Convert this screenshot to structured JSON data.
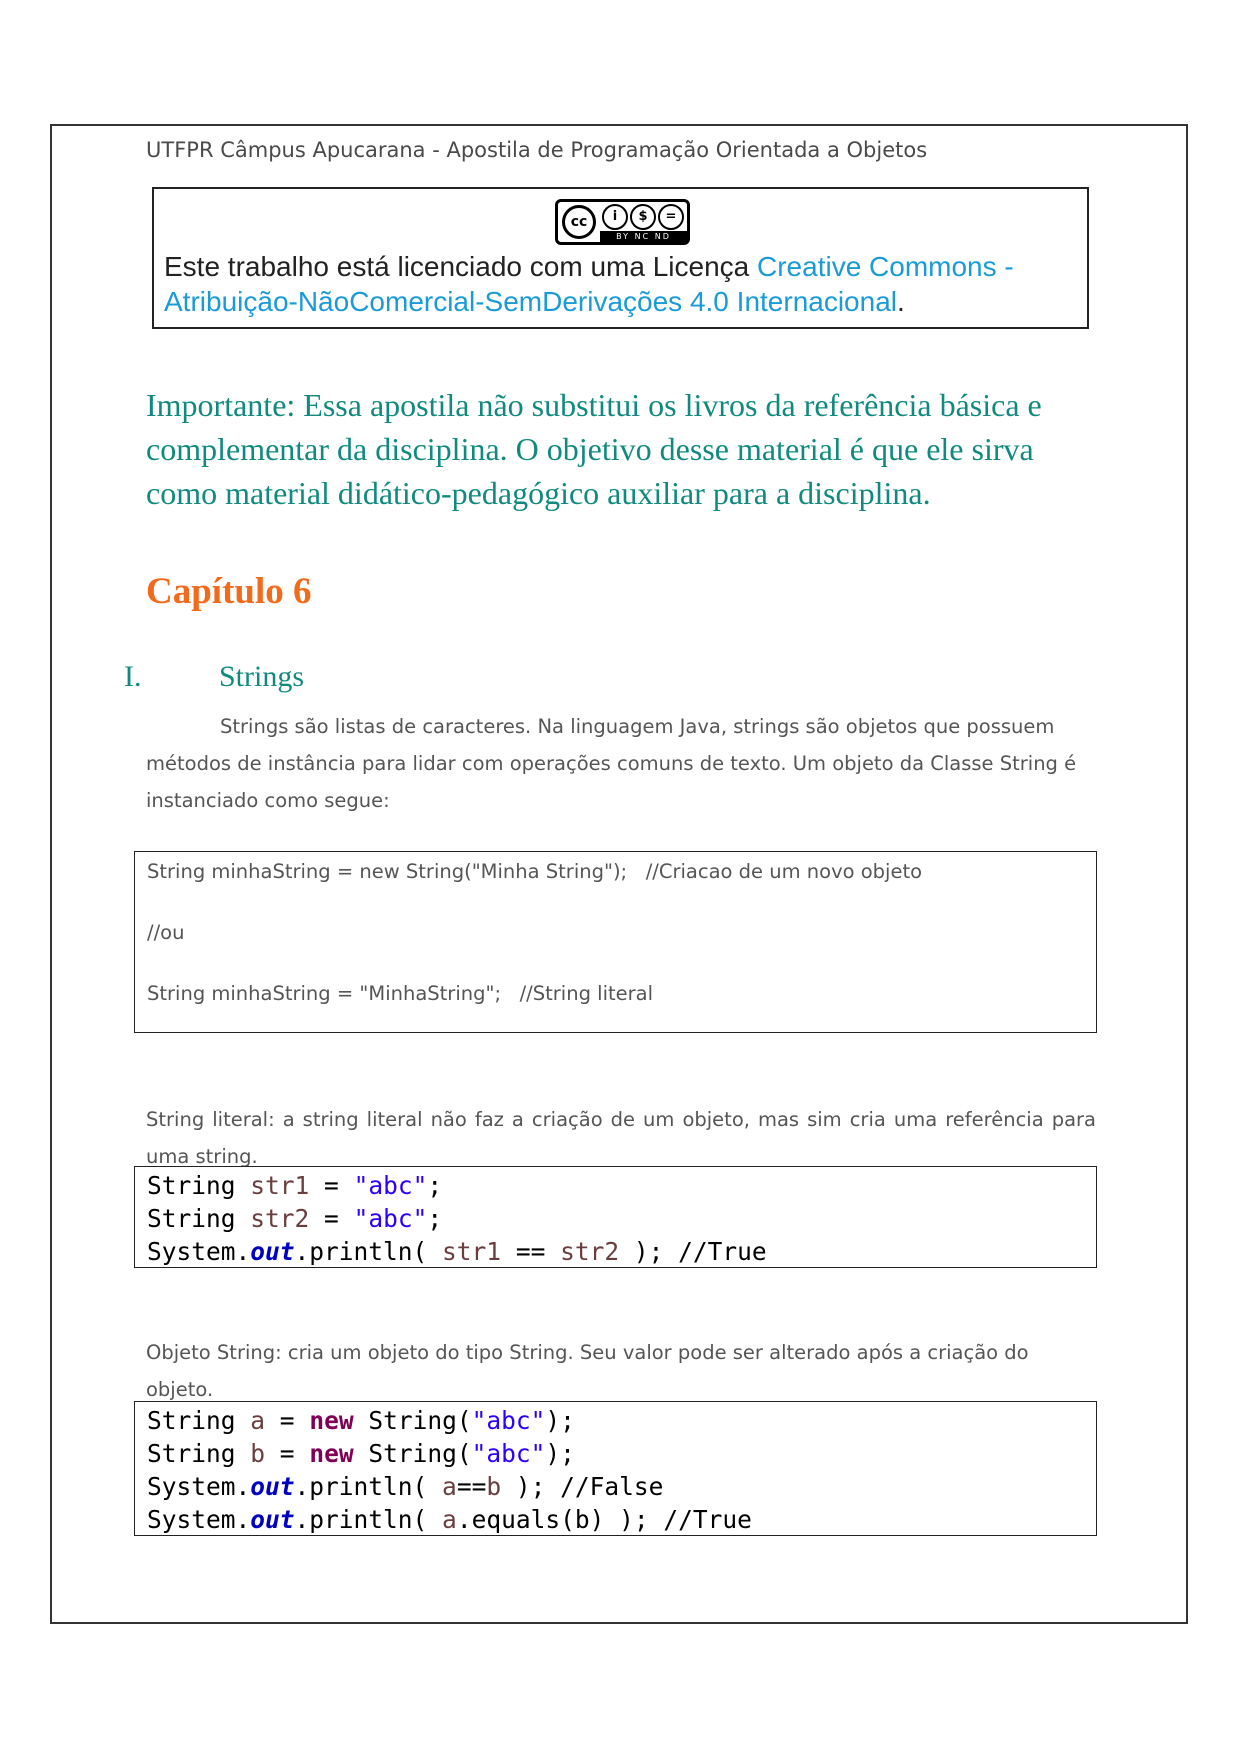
{
  "header": {
    "title": "UTFPR Câmpus Apucarana - Apostila de Programação Orientada a Objetos"
  },
  "license": {
    "badge": {
      "cc": "cc",
      "by": "i",
      "nc": "$",
      "nd": "=",
      "strip": "BY NC ND"
    },
    "text_prefix": "Este trabalho está licenciado com uma Licença ",
    "link_text": "Creative Commons - Atribuição-NãoComercial-SemDerivações 4.0 Internacional",
    "text_suffix": "."
  },
  "important_note": "Importante: Essa apostila não substitui os livros da referência básica e complementar da disciplina. O objetivo desse material é que ele sirva como material didático-pedagógico auxiliar para a disciplina.",
  "chapter": "Capítulo 6",
  "section": {
    "number": "I.",
    "title": "Strings"
  },
  "paragraphs": {
    "intro": "Strings são listas de caracteres. Na linguagem Java, strings são objetos que possuem métodos de instância para lidar com operações comuns de texto. Um objeto da Classe String é instanciado como segue:",
    "literal": "String literal: a string literal não faz a criação de um objeto, mas sim cria uma referência para uma string.",
    "object": "Objeto String: cria um objeto do tipo String. Seu valor pode ser alterado após a criação do objeto."
  },
  "code_block_1": {
    "line1": "String minhaString = new String(\"Minha String\");   //Criacao de um novo objeto",
    "line2": "//ou",
    "line3": "String minhaString = \"MinhaString\";   //String literal"
  },
  "code_block_2": {
    "type_kw": "String",
    "var1": "str1",
    "var2": "str2",
    "eq": " = ",
    "str_abc": "\"abc\"",
    "semi": ";",
    "system": "System.",
    "out": "out",
    "println_open": ".println( ",
    "op_eq": " == ",
    "close": " ); ",
    "comment_true": "//True"
  },
  "code_block_3": {
    "type_kw": "String",
    "var_a": "a",
    "var_b": "b",
    "eq": " = ",
    "new_kw": "new",
    "ctor_open": " String(",
    "str_abc": "\"abc\"",
    "ctor_close": ");",
    "system": "System.",
    "out": "out",
    "println_open": ".println( ",
    "op_eqeq": "==",
    "close": " ); ",
    "comment_false": "//False",
    "equals_call": ".equals(b)",
    "comment_true": "//True"
  }
}
